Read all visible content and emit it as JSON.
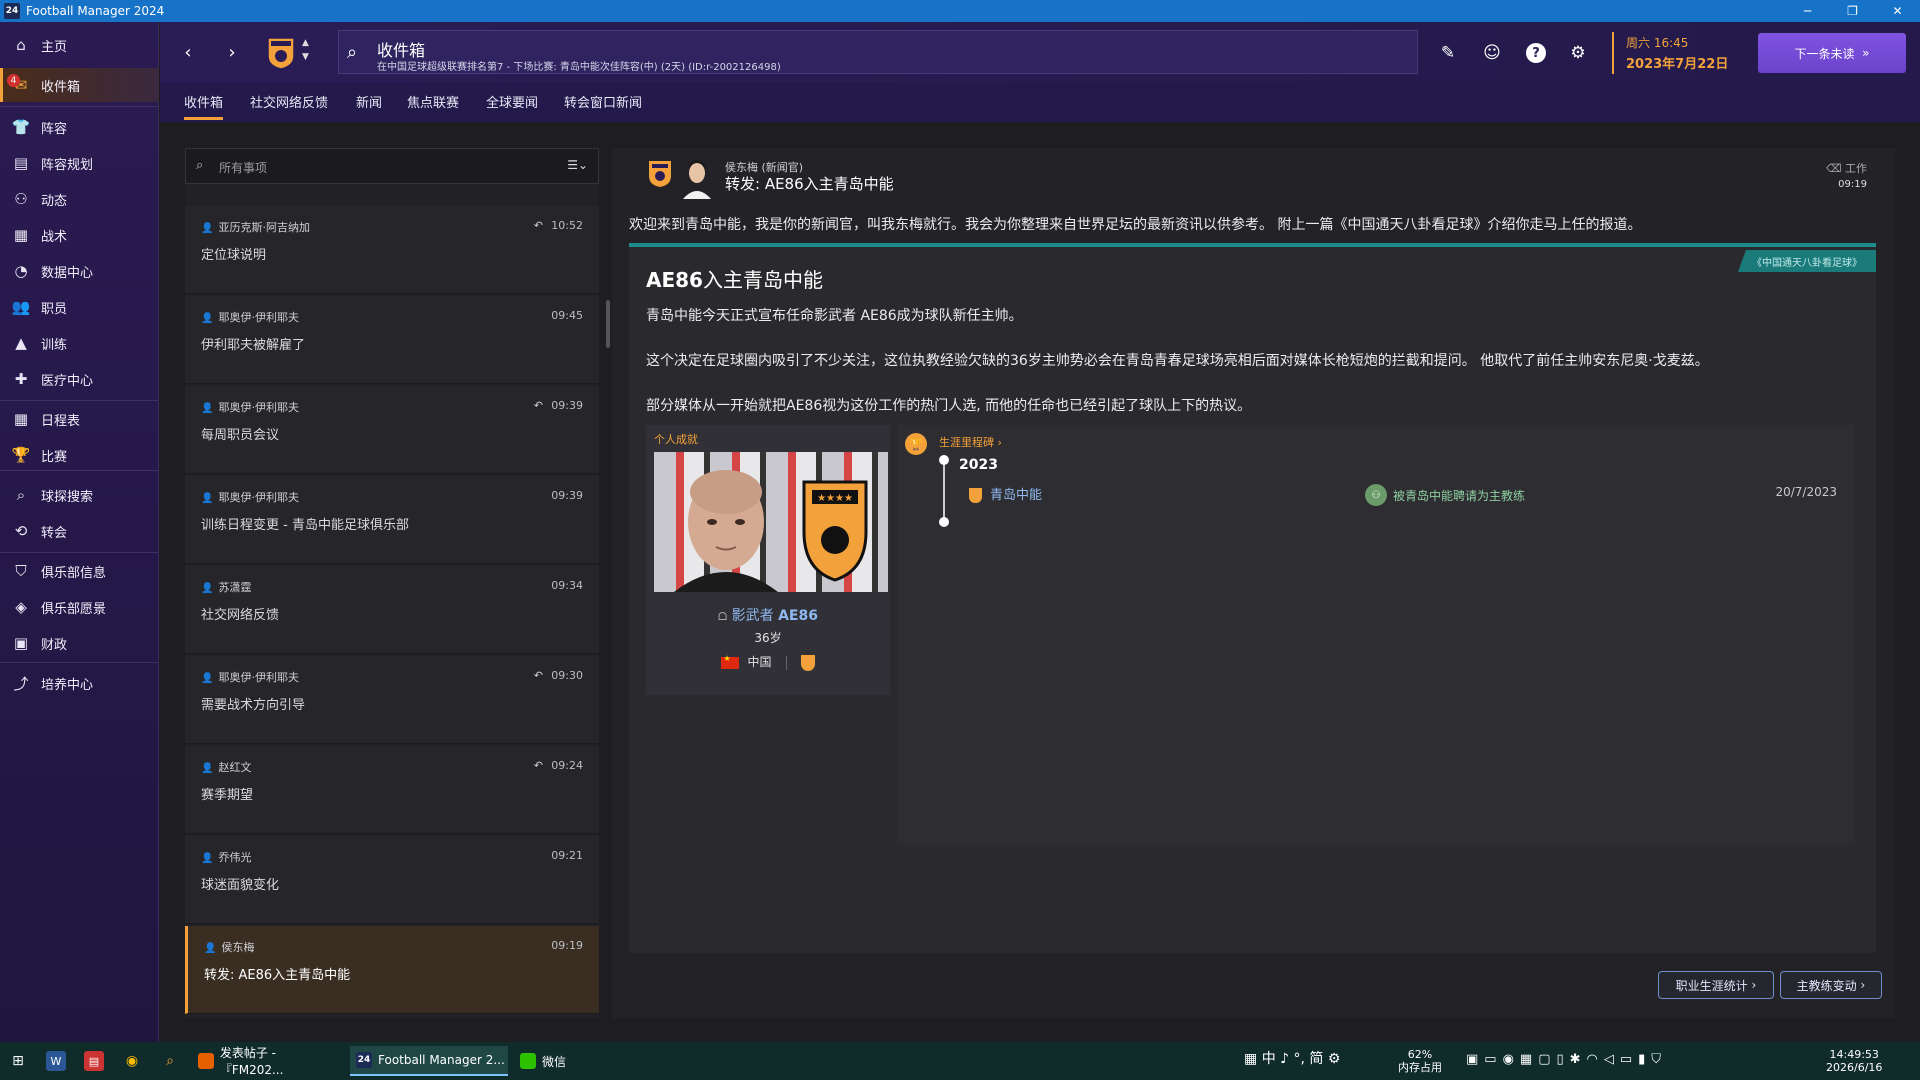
{
  "window": {
    "title": "Football Manager 2024",
    "app_icon": "24"
  },
  "nav": {
    "items": [
      {
        "label": "主页",
        "icon": "home-icon"
      },
      {
        "label": "收件箱",
        "icon": "inbox-icon",
        "badge": "4",
        "active": true
      },
      {
        "label": "阵容",
        "icon": "squad-icon"
      },
      {
        "label": "阵容规划",
        "icon": "squad-planner-icon"
      },
      {
        "label": "动态",
        "icon": "dynamics-icon"
      },
      {
        "label": "战术",
        "icon": "tactics-icon"
      },
      {
        "label": "数据中心",
        "icon": "data-hub-icon"
      },
      {
        "label": "职员",
        "icon": "staff-icon"
      },
      {
        "label": "训练",
        "icon": "training-icon"
      },
      {
        "label": "医疗中心",
        "icon": "medical-icon"
      },
      {
        "label": "日程表",
        "icon": "schedule-icon"
      },
      {
        "label": "比赛",
        "icon": "trophy-icon"
      },
      {
        "label": "球探搜索",
        "icon": "scouting-icon"
      },
      {
        "label": "转会",
        "icon": "transfers-icon"
      },
      {
        "label": "俱乐部信息",
        "icon": "club-info-icon"
      },
      {
        "label": "俱乐部愿景",
        "icon": "club-vision-icon"
      },
      {
        "label": "财政",
        "icon": "finances-icon"
      },
      {
        "label": "培养中心",
        "icon": "development-icon"
      }
    ]
  },
  "header": {
    "title": "收件箱",
    "subtitle": "在中国足球超级联赛排名第7 - 下场比赛: 青岛中能次佳阵容(中) (2天) (ID:r-2002126498)",
    "date_line1": "周六 16:45",
    "date_line2": "2023年7月22日",
    "continue_label": "下一条未读"
  },
  "tabs": [
    "收件箱",
    "社交网络反馈",
    "新闻",
    "焦点联赛",
    "全球要闻",
    "转会窗口新闻"
  ],
  "inbox": {
    "search_placeholder": "所有事项",
    "messages": [
      {
        "sender": "亚历克斯·阿吉纳加",
        "time": "10:52",
        "subject": "定位球说明",
        "replied": true
      },
      {
        "sender": "耶奥伊·伊利耶夫",
        "time": "09:45",
        "subject": "伊利耶夫被解雇了",
        "replied": false
      },
      {
        "sender": "耶奥伊·伊利耶夫",
        "time": "09:39",
        "subject": "每周职员会议",
        "replied": true
      },
      {
        "sender": "耶奥伊·伊利耶夫",
        "time": "09:39",
        "subject": "训练日程变更 - 青岛中能足球俱乐部",
        "replied": false
      },
      {
        "sender": "苏潇霆",
        "time": "09:34",
        "subject": "社交网络反馈",
        "replied": false
      },
      {
        "sender": "耶奥伊·伊利耶夫",
        "time": "09:30",
        "subject": "需要战术方向引导",
        "replied": true
      },
      {
        "sender": "赵红文",
        "time": "09:24",
        "subject": "赛季期望",
        "replied": true
      },
      {
        "sender": "乔伟光",
        "time": "09:21",
        "subject": "球迷面貌变化",
        "replied": false
      },
      {
        "sender": "侯东梅",
        "time": "09:19",
        "subject": "转发:  AE86入主青岛中能",
        "replied": false,
        "selected": true
      }
    ]
  },
  "detail": {
    "from": "侯东梅 (新闻官)",
    "subject": "转发:  AE86入主青岛中能",
    "category": "工作",
    "time": "09:19",
    "intro": "欢迎来到青岛中能，我是你的新闻官，叫我东梅就行。我会为你整理来自世界足坛的最新资讯以供参考。 附上一篇《中国通天八卦看足球》介绍你走马上任的报道。",
    "source": "《中国通天八卦看足球》",
    "article_title_bold": "AE86",
    "article_title_rest": "入主青岛中能",
    "paragraphs": [
      "青岛中能今天正式宣布任命影武者 AE86成为球队新任主帅。",
      "这个决定在足球圈内吸引了不少关注，这位执教经验欠缺的36岁主帅势必会在青岛青春足球场亮相后面对媒体长枪短炮的拦截和提问。 他取代了前任主帅安东尼奥·戈麦兹。",
      "部分媒体从一开始就把AE86视为这份工作的热门人选, 而他的任命也已经引起了球队上下的热议。"
    ],
    "achievements_label": "个人成就",
    "coach_first": "影武者",
    "coach_last": "AE86",
    "coach_age": "36岁",
    "coach_nation": "中国",
    "career_label": "生涯里程碑",
    "career_year": "2023",
    "career_club": "青岛中能",
    "career_event": "被青岛中能聘请为主教练",
    "career_date": "20/7/2023",
    "btn_career_stats": "职业生涯统计",
    "btn_manager_moves": "主教练变动"
  },
  "taskbar": {
    "apps": [
      {
        "label": "发表帖子 - 『FM202...",
        "icon": "firefox-icon"
      },
      {
        "label": "Football Manager 2...",
        "icon": "fm-icon",
        "active": true
      },
      {
        "label": "微信",
        "icon": "wechat-icon"
      }
    ],
    "ime": "中 ♪ °, 简",
    "mem_percent": "62%",
    "mem_label": "内存占用",
    "clock_time": "14:49:53",
    "clock_date": "2026/6/16"
  },
  "colors": {
    "accent": "#f3a13a",
    "nav_bg": "#2a1a52",
    "teal": "#1b8d8d",
    "link": "#8fb8f0"
  }
}
